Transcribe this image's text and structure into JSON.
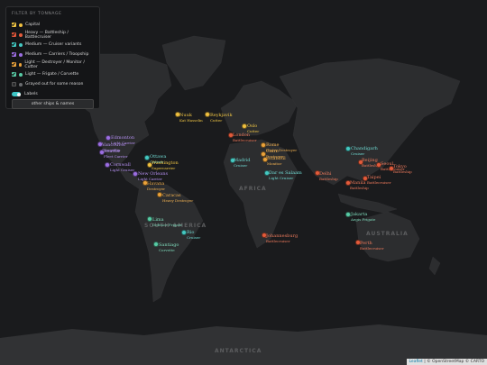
{
  "filter": {
    "title": "FILTER BY TONNAGE",
    "items": [
      {
        "label": "Capital",
        "checkbox_color": "#f2c744",
        "dot_color": "#f0c040",
        "checked": true
      },
      {
        "label": "Heavy — Battleship / Battlecruiser",
        "checkbox_color": "#e0563a",
        "dot_color": "#e35b3b",
        "checked": true
      },
      {
        "label": "Medium — Cruiser variants",
        "checkbox_color": "#3fc6c0",
        "dot_color": "#45c9c2",
        "checked": true
      },
      {
        "label": "Medium — Carriers / Troopship",
        "checkbox_color": "#9a6be0",
        "dot_color": "#9c6fe2",
        "checked": true
      },
      {
        "label": "Light — Destroyer / Monitor / Cutter",
        "checkbox_color": "#e9a23b",
        "dot_color": "#eba23a",
        "checked": true
      },
      {
        "label": "Light — Frigate / Corvette",
        "checkbox_color": "#56c9a4",
        "dot_color": "#58cba5",
        "checked": true
      },
      {
        "label": "Grayed out for some reason",
        "checkbox_color": "#2a2b2d",
        "dot_color": "#6b6d70",
        "checked": false
      }
    ],
    "labels_toggle": {
      "label": "Labels",
      "on": true
    },
    "button_label": "other ships & names"
  },
  "regions": [
    {
      "key": "africa",
      "text": "AFRICA"
    },
    {
      "key": "australia",
      "text": "AUSTRALIA"
    },
    {
      "key": "antarctica",
      "text": "ANTARCTICA"
    },
    {
      "key": "sa",
      "text": "SOUTH AMERICA"
    }
  ],
  "markers": [
    {
      "city": "Nuuk",
      "ship": "Kat Hasselin",
      "cls": "Capital"
    },
    {
      "city": "Reykjavik",
      "ship": "Cutter",
      "cls": "Capital"
    },
    {
      "city": "Edmonton",
      "ship": "Light Carrier",
      "cls": "Carrier"
    },
    {
      "city": "Vancouver",
      "ship": "Troopship",
      "cls": "Carrier"
    },
    {
      "city": "Seattle",
      "ship": "Fleet Carrier",
      "cls": "Carrier"
    },
    {
      "city": "Cornwall",
      "ship": "Light Cruiser",
      "cls": "Carrier"
    },
    {
      "city": "Ottawa",
      "ship": "Cruiser",
      "cls": "Cruiser"
    },
    {
      "city": "Washington",
      "ship": "Supercarrier",
      "cls": "Capital"
    },
    {
      "city": "New Orleans",
      "ship": "Light Carrier",
      "cls": "Carrier"
    },
    {
      "city": "Havana",
      "ship": "Destroyer",
      "cls": "Destroyer"
    },
    {
      "city": "Caracas",
      "ship": "Heavy Destroyer",
      "cls": "Destroyer"
    },
    {
      "city": "Lima",
      "ship": "Defence Frigate",
      "cls": "Frigate"
    },
    {
      "city": "Santiago",
      "ship": "Corvette",
      "cls": "Frigate"
    },
    {
      "city": "Rio",
      "ship": "Cruiser",
      "cls": "Cruiser"
    },
    {
      "city": "Oslo",
      "ship": "Cutter",
      "cls": "Capital"
    },
    {
      "city": "London",
      "ship": "Battlecruiser",
      "cls": "Heavy"
    },
    {
      "city": "Madrid",
      "ship": "Cruiser",
      "cls": "Cruiser"
    },
    {
      "city": "Rome",
      "ship": "Heavy Destroyer",
      "cls": "Destroyer"
    },
    {
      "city": "Istanbul",
      "ship": "Monitor",
      "cls": "Destroyer"
    },
    {
      "city": "Cairo",
      "ship": "Destroyer",
      "cls": "Destroyer"
    },
    {
      "city": "Dar es Salaam",
      "ship": "Light Cruiser",
      "cls": "Cruiser"
    },
    {
      "city": "Johannesburg",
      "ship": "Battlecruiser",
      "cls": "Heavy"
    },
    {
      "city": "Delhi",
      "ship": "Battleship",
      "cls": "Heavy"
    },
    {
      "city": "Chandigarh",
      "ship": "Cruiser",
      "cls": "Cruiser"
    },
    {
      "city": "Beijing",
      "ship": "Battleship",
      "cls": "Heavy"
    },
    {
      "city": "Seoul",
      "ship": "Battlecruiser",
      "cls": "Heavy"
    },
    {
      "city": "Tokyo",
      "ship": "Battleship",
      "cls": "Heavy"
    },
    {
      "city": "Taipei",
      "ship": "Battlecruiser",
      "cls": "Heavy"
    },
    {
      "city": "Manila",
      "ship": "Battleship",
      "cls": "Heavy"
    },
    {
      "city": "Jakarta",
      "ship": "Aegis Frigate",
      "cls": "Frigate"
    },
    {
      "city": "Perth",
      "ship": "Battlecruiser",
      "cls": "Heavy"
    }
  ],
  "attribution": {
    "leaflet": "Leaflet",
    "text": " | © OpenStreetMap © CARTO"
  }
}
